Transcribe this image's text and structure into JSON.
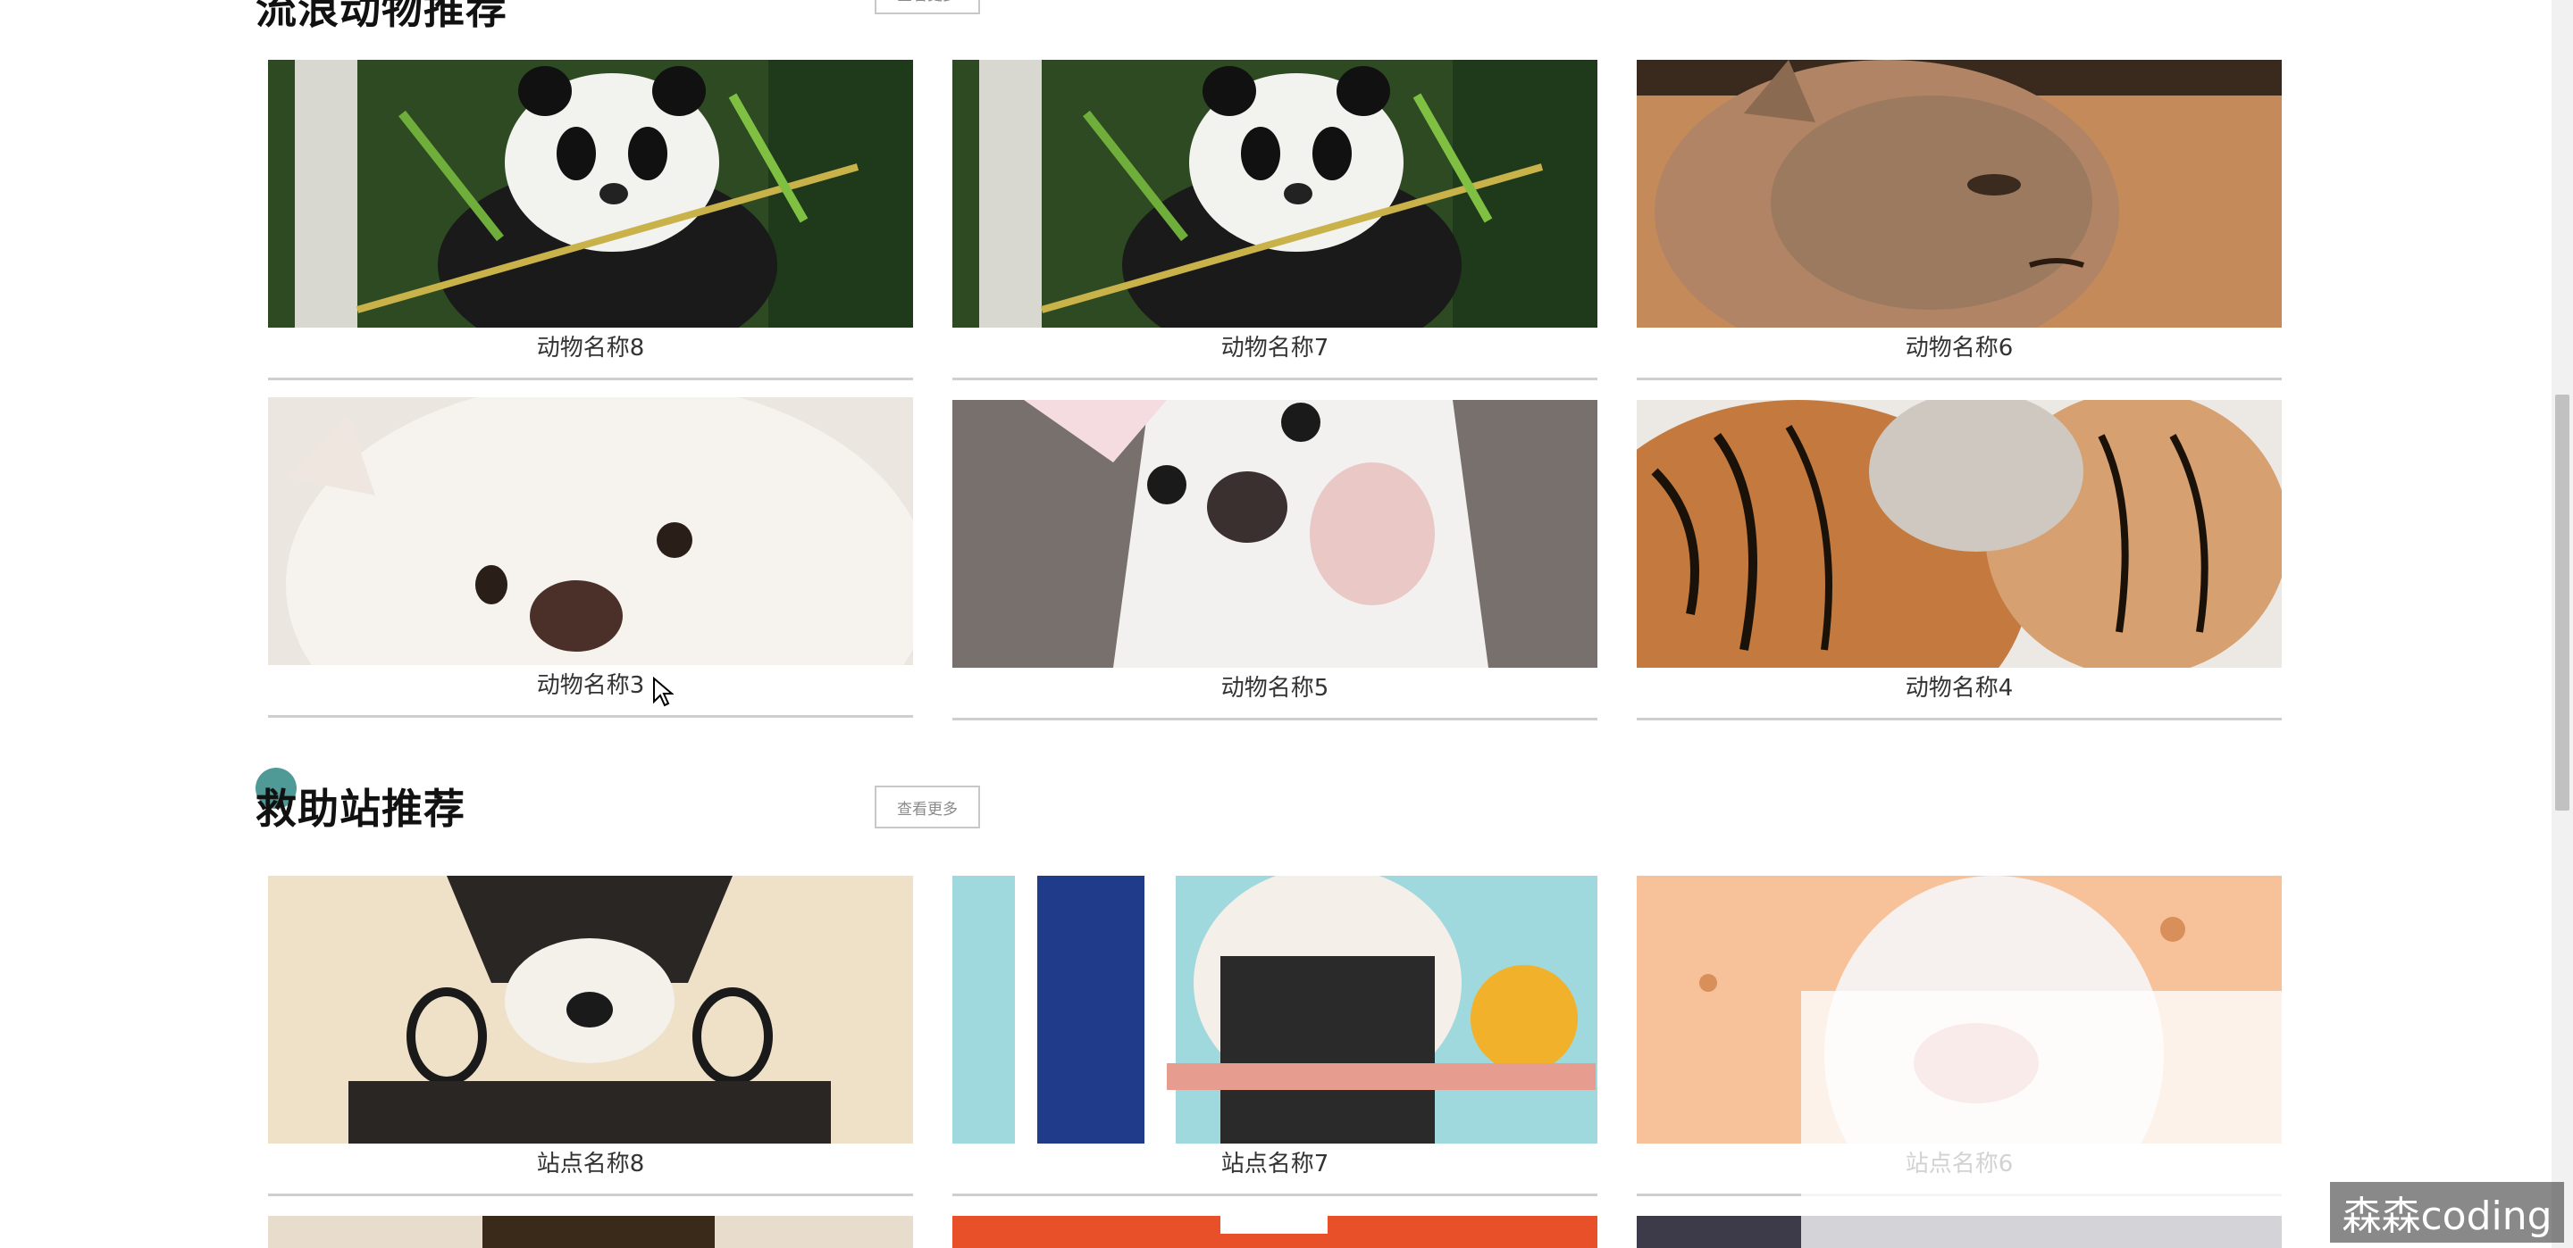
{
  "sections": {
    "animals": {
      "title": "流浪动物推荐",
      "more_label": "查看更多",
      "items": [
        {
          "name": "动物名称8",
          "image": "panda-photo"
        },
        {
          "name": "动物名称7",
          "image": "panda-photo"
        },
        {
          "name": "动物名称6",
          "image": "lynx-photo"
        },
        {
          "name": "动物名称3",
          "image": "white-dog-photo"
        },
        {
          "name": "动物名称5",
          "image": "french-bulldog-photo"
        },
        {
          "name": "动物名称4",
          "image": "tigers-photo"
        }
      ]
    },
    "stations": {
      "title": "救助站推荐",
      "more_label": "查看更多",
      "items": [
        {
          "name": "站点名称8",
          "image": "husky-logo-poster"
        },
        {
          "name": "站点名称7",
          "image": "pet-cartoon-poster"
        },
        {
          "name": "站点名称6",
          "image": "white-cat-poster"
        }
      ]
    }
  },
  "watermark": "森森coding",
  "colors": {
    "accent_dot": "#3c8f8c",
    "border": "#cfcfcf"
  }
}
